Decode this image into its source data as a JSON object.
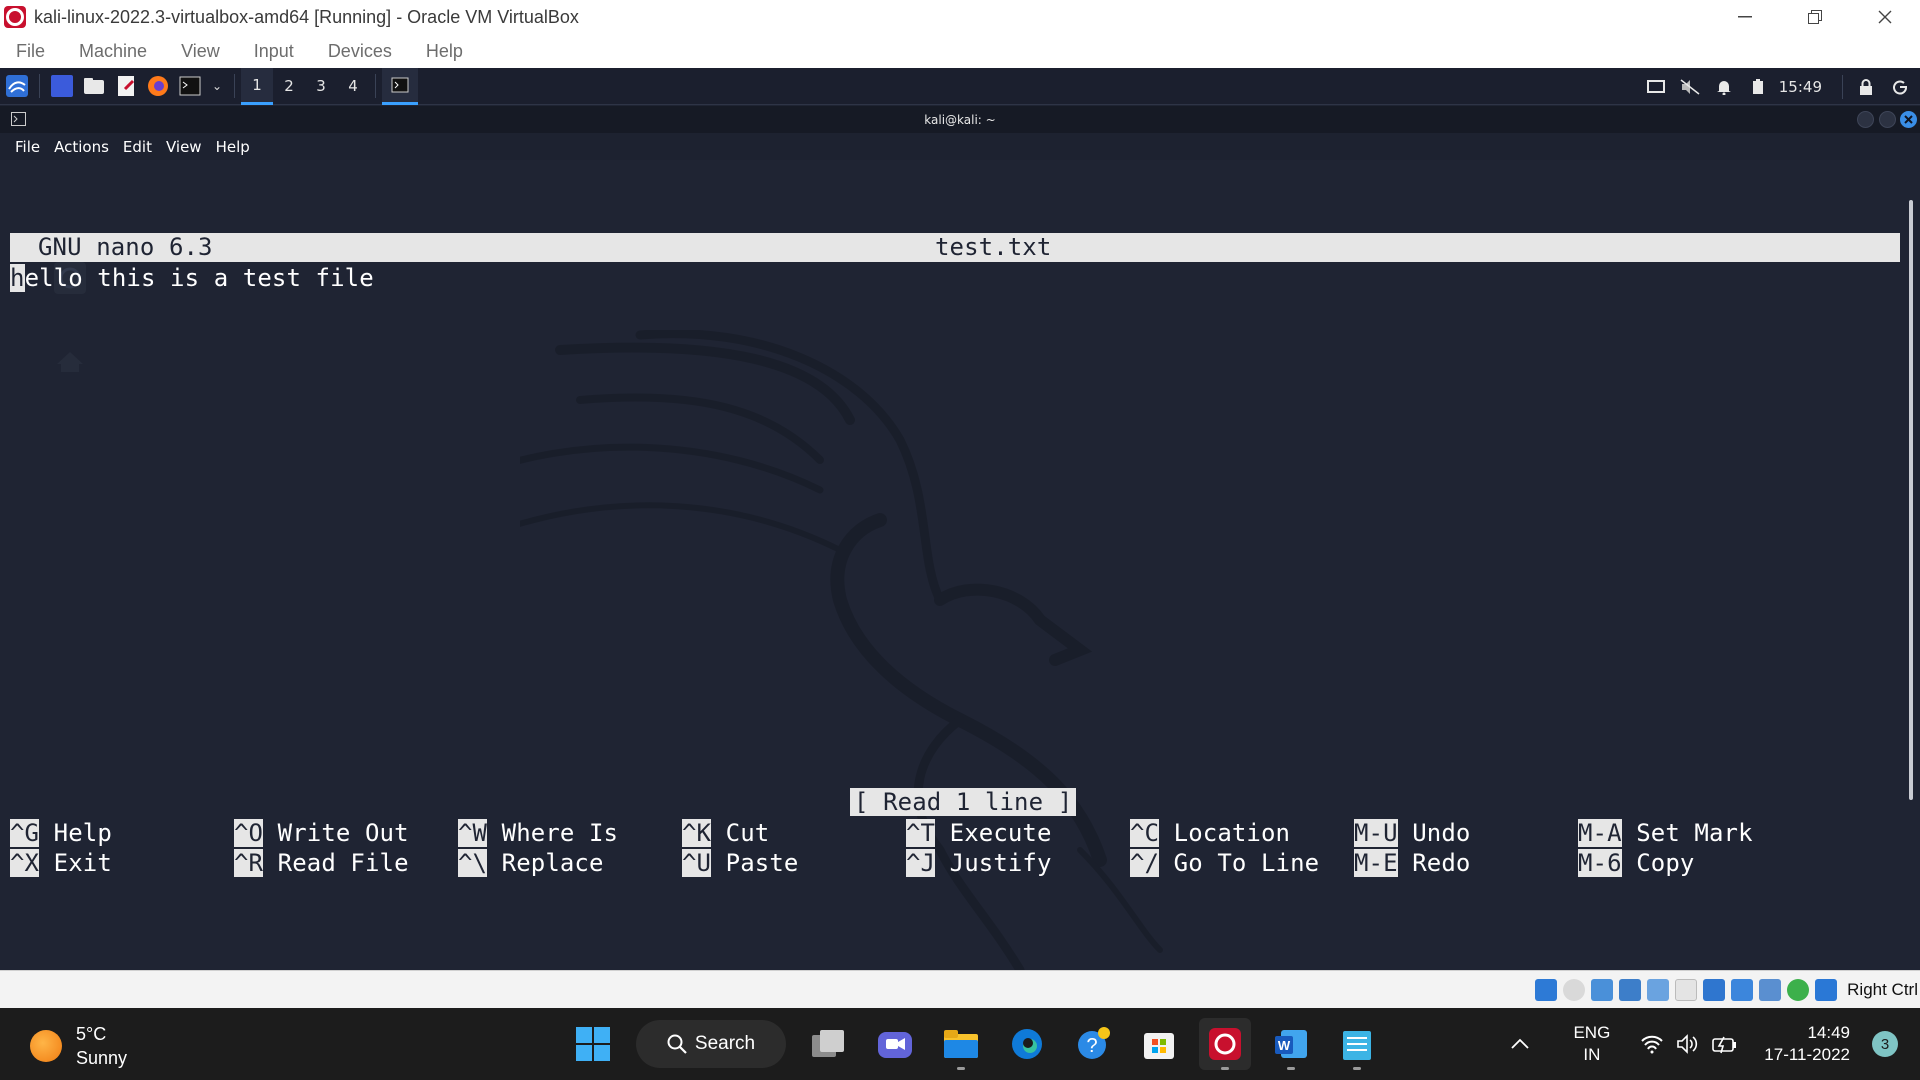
{
  "vbox": {
    "title": "kali-linux-2022.3-virtualbox-amd64 [Running] - Oracle VM VirtualBox",
    "menu": [
      "File",
      "Machine",
      "View",
      "Input",
      "Devices",
      "Help"
    ],
    "host_key": "Right Ctrl"
  },
  "panel": {
    "workspaces": [
      "1",
      "2",
      "3",
      "4"
    ],
    "clock": "15:49"
  },
  "terminal": {
    "title": "kali@kali: ~",
    "menu": [
      "File",
      "Actions",
      "Edit",
      "View",
      "Help"
    ]
  },
  "nano": {
    "version": "GNU nano 6.3",
    "filename": "test.txt",
    "cursor_char": "h",
    "line_rest": "ello this is a test file",
    "status": "[ Read 1 line ]",
    "shortcuts": [
      {
        "key": "^G",
        "label": "Help"
      },
      {
        "key": "^X",
        "label": "Exit"
      },
      {
        "key": "^O",
        "label": "Write Out"
      },
      {
        "key": "^R",
        "label": "Read File"
      },
      {
        "key": "^W",
        "label": "Where Is"
      },
      {
        "key": "^\\",
        "label": "Replace"
      },
      {
        "key": "^K",
        "label": "Cut"
      },
      {
        "key": "^U",
        "label": "Paste"
      },
      {
        "key": "^T",
        "label": "Execute"
      },
      {
        "key": "^J",
        "label": "Justify"
      },
      {
        "key": "^C",
        "label": "Location"
      },
      {
        "key": "^/",
        "label": "Go To Line"
      },
      {
        "key": "M-U",
        "label": "Undo"
      },
      {
        "key": "M-E",
        "label": "Redo"
      },
      {
        "key": "M-A",
        "label": "Set Mark"
      },
      {
        "key": "M-6",
        "label": "Copy"
      }
    ]
  },
  "taskbar": {
    "weather_temp": "5°C",
    "weather_desc": "Sunny",
    "search_label": "Search",
    "lang_1": "ENG",
    "lang_2": "IN",
    "time": "14:49",
    "date": "17-11-2022",
    "notifications": "3"
  },
  "colors": {
    "guest_bg": "#1f2433",
    "nano_bar": "#e6e6e6",
    "accent": "#3aa0ff",
    "taskbar": "#1c1c1c"
  }
}
